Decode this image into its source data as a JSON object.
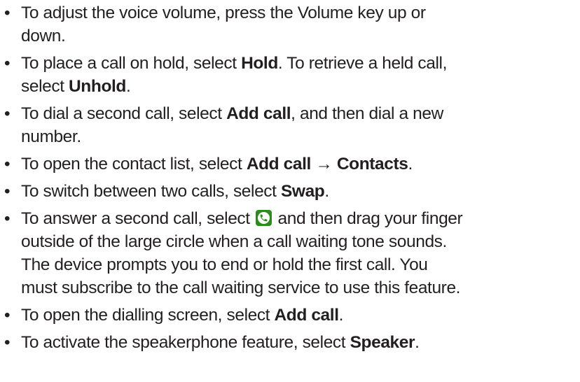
{
  "bullet_char": "•",
  "items": [
    {
      "lines": [
        {
          "parts": [
            {
              "t": "To adjust the voice volume, press the Volume key up or"
            }
          ]
        },
        {
          "parts": [
            {
              "t": "down."
            }
          ]
        }
      ]
    },
    {
      "lines": [
        {
          "parts": [
            {
              "t": "To place a call on hold, select "
            },
            {
              "t": "Hold",
              "b": true
            },
            {
              "t": ". To retrieve a held call,"
            }
          ]
        },
        {
          "parts": [
            {
              "t": "select "
            },
            {
              "t": "Unhold",
              "b": true
            },
            {
              "t": "."
            }
          ]
        }
      ]
    },
    {
      "lines": [
        {
          "parts": [
            {
              "t": "To dial a second call, select "
            },
            {
              "t": "Add call",
              "b": true
            },
            {
              "t": ", and then dial a new"
            }
          ]
        },
        {
          "parts": [
            {
              "t": "number."
            }
          ]
        }
      ]
    },
    {
      "lines": [
        {
          "parts": [
            {
              "t": "To open the contact list, select "
            },
            {
              "t": "Add call",
              "b": true
            },
            {
              "t": " → "
            },
            {
              "t": "Contacts",
              "b": true
            },
            {
              "t": "."
            }
          ]
        }
      ]
    },
    {
      "lines": [
        {
          "parts": [
            {
              "t": "To switch between two calls, select "
            },
            {
              "t": "Swap",
              "b": true
            },
            {
              "t": "."
            }
          ]
        }
      ]
    },
    {
      "lines": [
        {
          "parts": [
            {
              "t": "To answer a second call, select "
            },
            {
              "icon": "phone-answer-icon"
            },
            {
              "t": " and then drag your finger"
            }
          ]
        },
        {
          "parts": [
            {
              "t": "outside of the large circle when a call waiting tone sounds."
            }
          ]
        },
        {
          "parts": [
            {
              "t": "The device prompts you to end or hold the first call. You"
            }
          ]
        },
        {
          "parts": [
            {
              "t": "must subscribe to the call waiting service to use this feature."
            }
          ]
        }
      ]
    },
    {
      "lines": [
        {
          "parts": [
            {
              "t": "To open the dialling screen, select "
            },
            {
              "t": "Add call",
              "b": true
            },
            {
              "t": "."
            }
          ]
        }
      ]
    },
    {
      "lines": [
        {
          "parts": [
            {
              "t": "To activate the speakerphone feature, select "
            },
            {
              "t": "Speaker",
              "b": true
            },
            {
              "t": "."
            }
          ]
        }
      ]
    }
  ],
  "colors": {
    "text": "#231f20",
    "icon_bg": "#2c8a1f"
  }
}
